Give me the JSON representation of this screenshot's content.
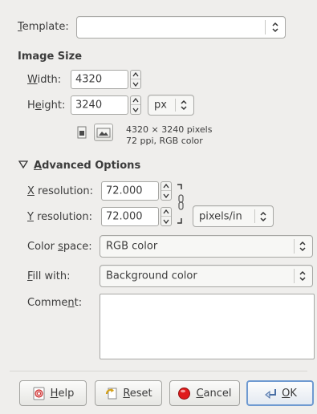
{
  "template": {
    "label": "Template:",
    "value": ""
  },
  "image_size": {
    "title": "Image Size",
    "width_label": "Width:",
    "width_value": "4320",
    "height_label": "Height:",
    "height_value": "3240",
    "unit": "px",
    "info_line1": "4320 × 3240 pixels",
    "info_line2": "72 ppi, RGB color"
  },
  "advanced": {
    "title": "Advanced Options",
    "x_res_label": "X resolution:",
    "x_res_value": "72.000",
    "y_res_label": "Y resolution:",
    "y_res_value": "72.000",
    "res_unit": "pixels/in",
    "color_space_label": "Color space:",
    "color_space_value": "RGB color",
    "fill_label": "Fill with:",
    "fill_value": "Background color",
    "comment_label": "Comment:",
    "comment_value": ""
  },
  "buttons": {
    "help": "Help",
    "reset": "Reset",
    "cancel": "Cancel",
    "ok": "OK"
  },
  "icons": {
    "help": "help-icon",
    "reset": "reset-icon",
    "cancel": "cancel-icon",
    "ok": "ok-icon",
    "chain": "chain-link-icon",
    "portrait": "portrait-orientation-icon",
    "landscape": "landscape-orientation-icon"
  }
}
